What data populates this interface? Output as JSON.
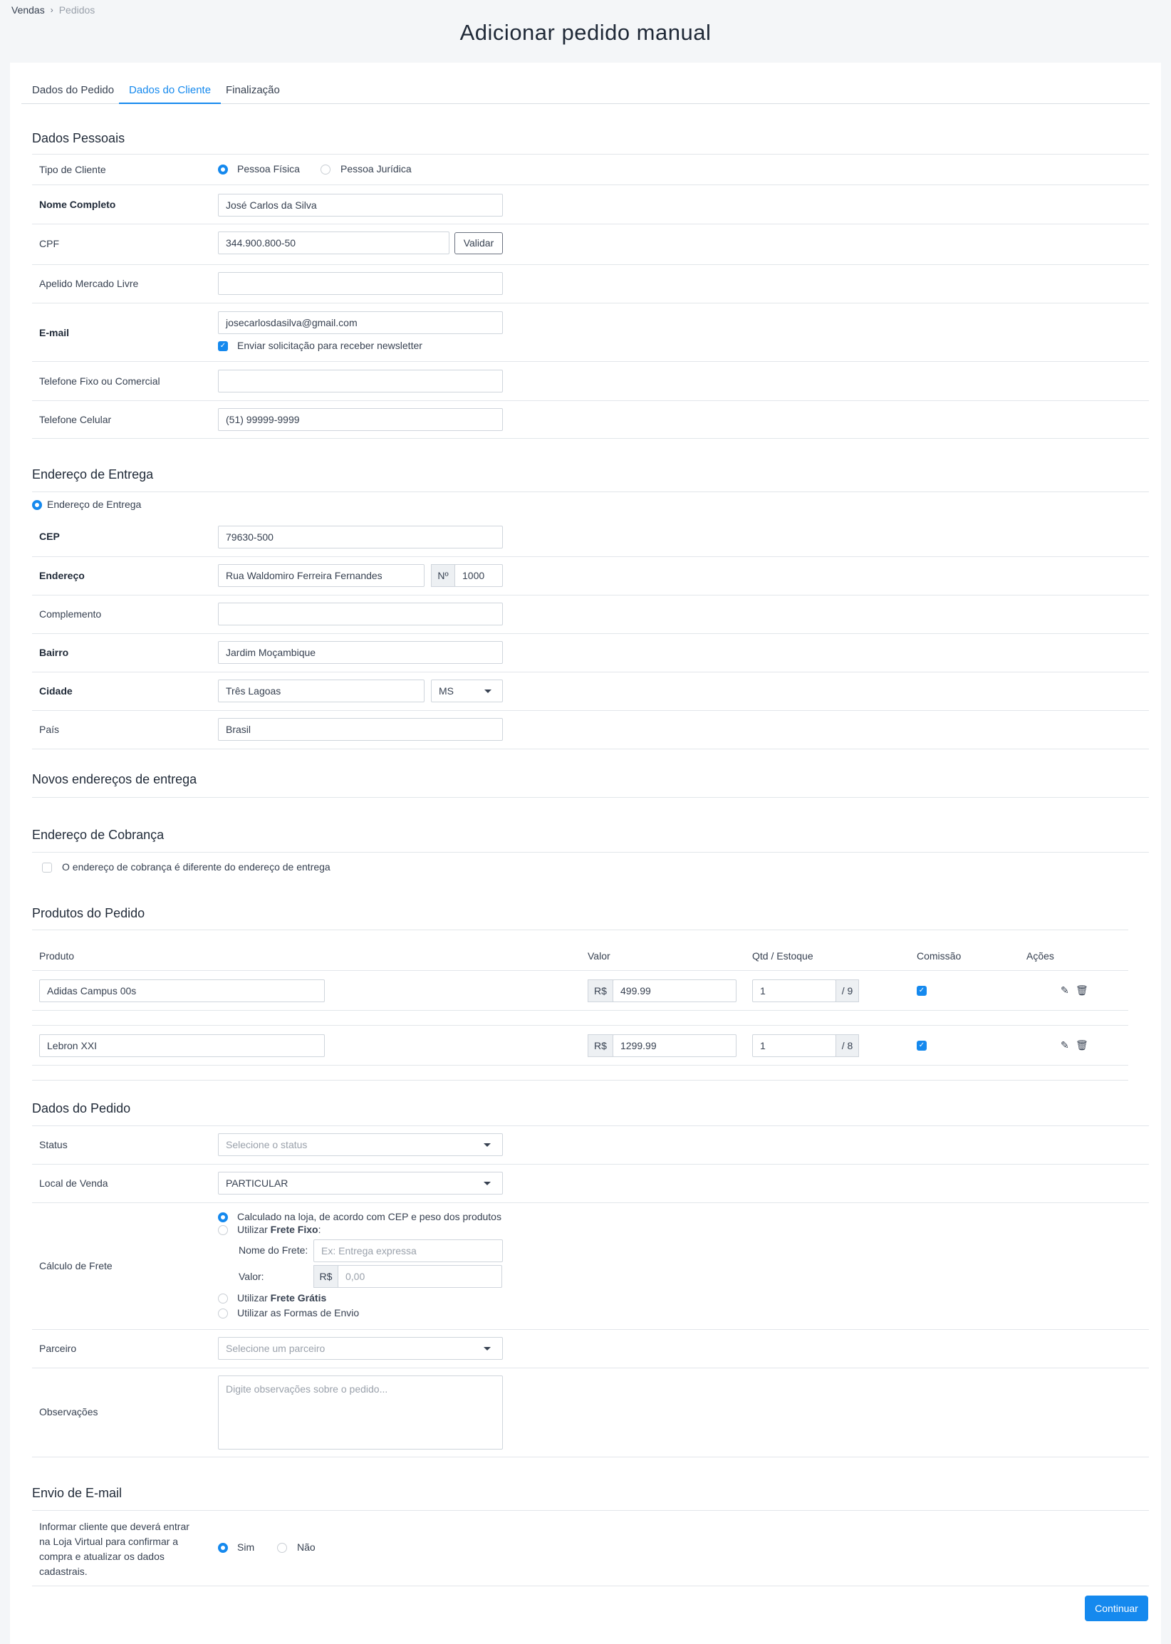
{
  "breadcrumb": {
    "root": "Vendas",
    "current": "Pedidos"
  },
  "page_title": "Adicionar pedido manual",
  "tabs": [
    "Dados do Pedido",
    "Dados do Cliente",
    "Finalização"
  ],
  "personal": {
    "title": "Dados Pessoais",
    "tipo_label": "Tipo de Cliente",
    "pf": "Pessoa Física",
    "pj": "Pessoa Jurídica",
    "nome_label": "Nome Completo",
    "nome": "José Carlos da Silva",
    "cpf_label": "CPF",
    "cpf": "344.900.800-50",
    "validar": "Validar",
    "apelido_label": "Apelido Mercado Livre",
    "apelido": "",
    "email_label": "E-mail",
    "email": "josecarlosdasilva@gmail.com",
    "newsletter": "Enviar solicitação para receber newsletter",
    "fixo_label": "Telefone Fixo ou Comercial",
    "fixo": "",
    "cel_label": "Telefone Celular",
    "cel": "(51) 99999-9999"
  },
  "delivery": {
    "title": "Endereço de Entrega",
    "radio": "Endereço de Entrega",
    "cep_label": "CEP",
    "cep": "79630-500",
    "end_label": "Endereço",
    "endereco": "Rua Waldomiro Ferreira Fernandes",
    "num_prefix": "Nº",
    "numero": "1000",
    "comp_label": "Complemento",
    "complemento": "",
    "bairro_label": "Bairro",
    "bairro": "Jardim Moçambique",
    "cidade_label": "Cidade",
    "cidade": "Três Lagoas",
    "uf": "MS",
    "pais_label": "País",
    "pais": "Brasil"
  },
  "new_addresses": {
    "title": "Novos endereços de entrega"
  },
  "billing": {
    "title": "Endereço de Cobrança",
    "check": "O endereço de cobrança é diferente do endereço de entrega"
  },
  "products": {
    "title": "Produtos do Pedido",
    "headers": [
      "Produto",
      "Valor",
      "Qtd / Estoque",
      "Comissão",
      "Ações"
    ],
    "currency": "R$",
    "rows": [
      {
        "name": "Adidas Campus 00s",
        "price": "499.99",
        "qty": "1",
        "stock": "/ 9"
      },
      {
        "name": "Lebron XXI",
        "price": "1299.99",
        "qty": "1",
        "stock": "/ 8"
      }
    ]
  },
  "order": {
    "title": "Dados do Pedido",
    "status_label": "Status",
    "status_ph": "Selecione o status",
    "local_label": "Local de Venda",
    "local": "PARTICULAR",
    "frete_label": "Cálculo de Frete",
    "frete_opt1": "Calculado na loja, de acordo com CEP e peso dos produtos",
    "frete_opt2_pre": "Utilizar ",
    "frete_opt2_b": "Frete Fixo",
    "nome_frete_label": "Nome do Frete:",
    "nome_frete_ph": "Ex: Entrega expressa",
    "valor_label": "Valor:",
    "currency": "R$",
    "valor_ph": "0,00",
    "frete_opt3_pre": "Utilizar ",
    "frete_opt3_b": "Frete Grátis",
    "frete_opt4": "Utilizar as Formas de Envio",
    "parceiro_label": "Parceiro",
    "parceiro_ph": "Selecione um parceiro",
    "obs_label": "Observações",
    "obs_ph": "Digite observações sobre o pedido..."
  },
  "email_send": {
    "title": "Envio de E-mail",
    "text_l1": "Informar cliente que deverá entrar",
    "text_l2": "na Loja Virtual para confirmar a",
    "text_l3": "compra e atualizar os dados",
    "text_l4": "cadastrais.",
    "sim": "Sim",
    "nao": "Não"
  },
  "continue": "Continuar"
}
